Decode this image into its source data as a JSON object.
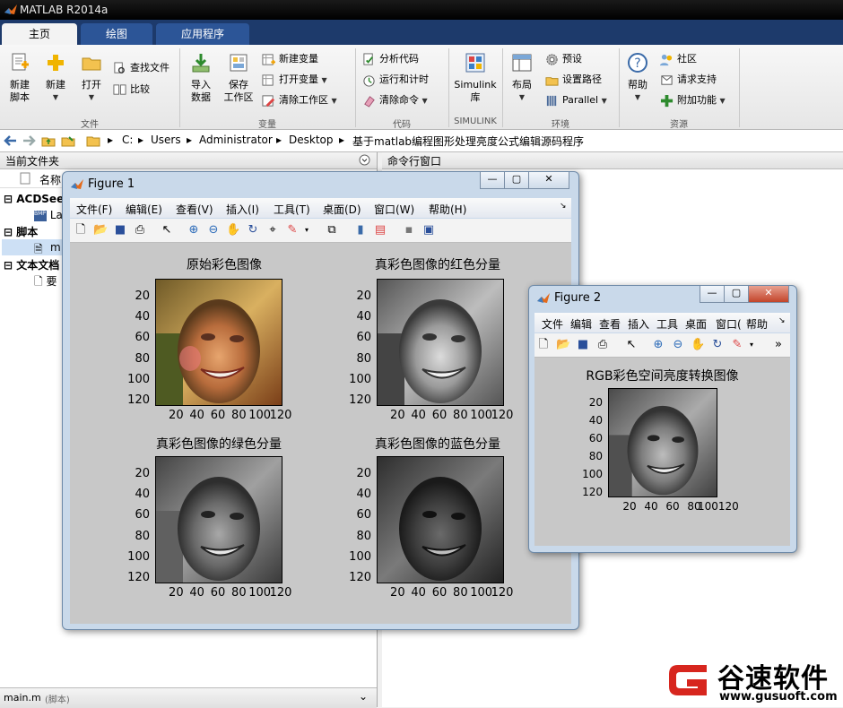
{
  "window": {
    "title": "MATLAB R2014a"
  },
  "tabs": [
    {
      "label": "主页",
      "active": true
    },
    {
      "label": "绘图",
      "active": false
    },
    {
      "label": "应用程序",
      "active": false
    }
  ],
  "ribbon": {
    "file": {
      "new_script": [
        "新建",
        "脚本"
      ],
      "new": "新建",
      "open": "打开",
      "find_files": "查找文件",
      "compare": "比较",
      "section": "文件"
    },
    "variable": {
      "import": [
        "导入",
        "数据"
      ],
      "save_ws": [
        "保存",
        "工作区"
      ],
      "new_var": "新建变量",
      "open_var": "打开变量",
      "clear_ws": "清除工作区",
      "section": "变量"
    },
    "code": {
      "analyze": "分析代码",
      "run_time": "运行和计时",
      "clear_cmds": "清除命令",
      "section": "代码"
    },
    "simulink": {
      "lib": [
        "Simulink",
        "库"
      ],
      "section": "SIMULINK"
    },
    "env": {
      "layout": "布局",
      "prefs": "预设",
      "set_path": "设置路径",
      "parallel": "Parallel",
      "section": "环境"
    },
    "resources": {
      "help": "帮助",
      "community": "社区",
      "request_support": "请求支持",
      "addons": "附加功能",
      "section": "资源"
    }
  },
  "address": {
    "crumbs": [
      "C:",
      "Users",
      "Administrator",
      "Desktop",
      "基于matlab编程图形处理亮度公式编辑源码程序"
    ]
  },
  "left_panel": {
    "title": "当前文件夹",
    "col_name": "名称",
    "tree": [
      {
        "label": "ACDSee",
        "type": "group"
      },
      {
        "label": "La",
        "type": "item"
      },
      {
        "label": "脚本",
        "type": "group"
      },
      {
        "label": "m",
        "type": "item"
      },
      {
        "label": "文本文档",
        "type": "group"
      },
      {
        "label": "要",
        "type": "item"
      }
    ],
    "status": "main.m",
    "status_note": "(脚本)"
  },
  "command_panel": {
    "title": "命令行窗口"
  },
  "figure1": {
    "title": "Figure 1",
    "menus": [
      "文件(F)",
      "编辑(E)",
      "查看(V)",
      "插入(I)",
      "工具(T)",
      "桌面(D)",
      "窗口(W)",
      "帮助(H)"
    ],
    "plots": [
      {
        "title": "原始彩色图像",
        "kind": "color"
      },
      {
        "title": "真彩色图像的红色分量",
        "kind": "red"
      },
      {
        "title": "真彩色图像的绿色分量",
        "kind": "green"
      },
      {
        "title": "真彩色图像的蓝色分量",
        "kind": "blue"
      }
    ],
    "yticks": [
      "20",
      "40",
      "60",
      "80",
      "100",
      "120"
    ],
    "xticks": [
      "20",
      "40",
      "60",
      "80",
      "100",
      "120"
    ]
  },
  "figure2": {
    "title": "Figure 2",
    "menus": [
      "文件",
      "编辑",
      "查看",
      "插入",
      "工具",
      "桌面",
      "窗口(",
      "帮助"
    ],
    "more": "»",
    "plot_title": "RGB彩色空间亮度转换图像",
    "yticks": [
      "20",
      "40",
      "60",
      "80",
      "100",
      "120"
    ],
    "xticks": [
      "20",
      "40",
      "60",
      "80",
      "100120"
    ]
  },
  "watermark": {
    "brand": "谷速软件",
    "url": "www.gusuoft.com"
  },
  "colors": {
    "titlebar": "#000000",
    "tabs": "#1d3a6b",
    "figure_frame": "#c9d9ea",
    "canvas": "#c8c8c8",
    "brand_red": "#d7261e"
  }
}
